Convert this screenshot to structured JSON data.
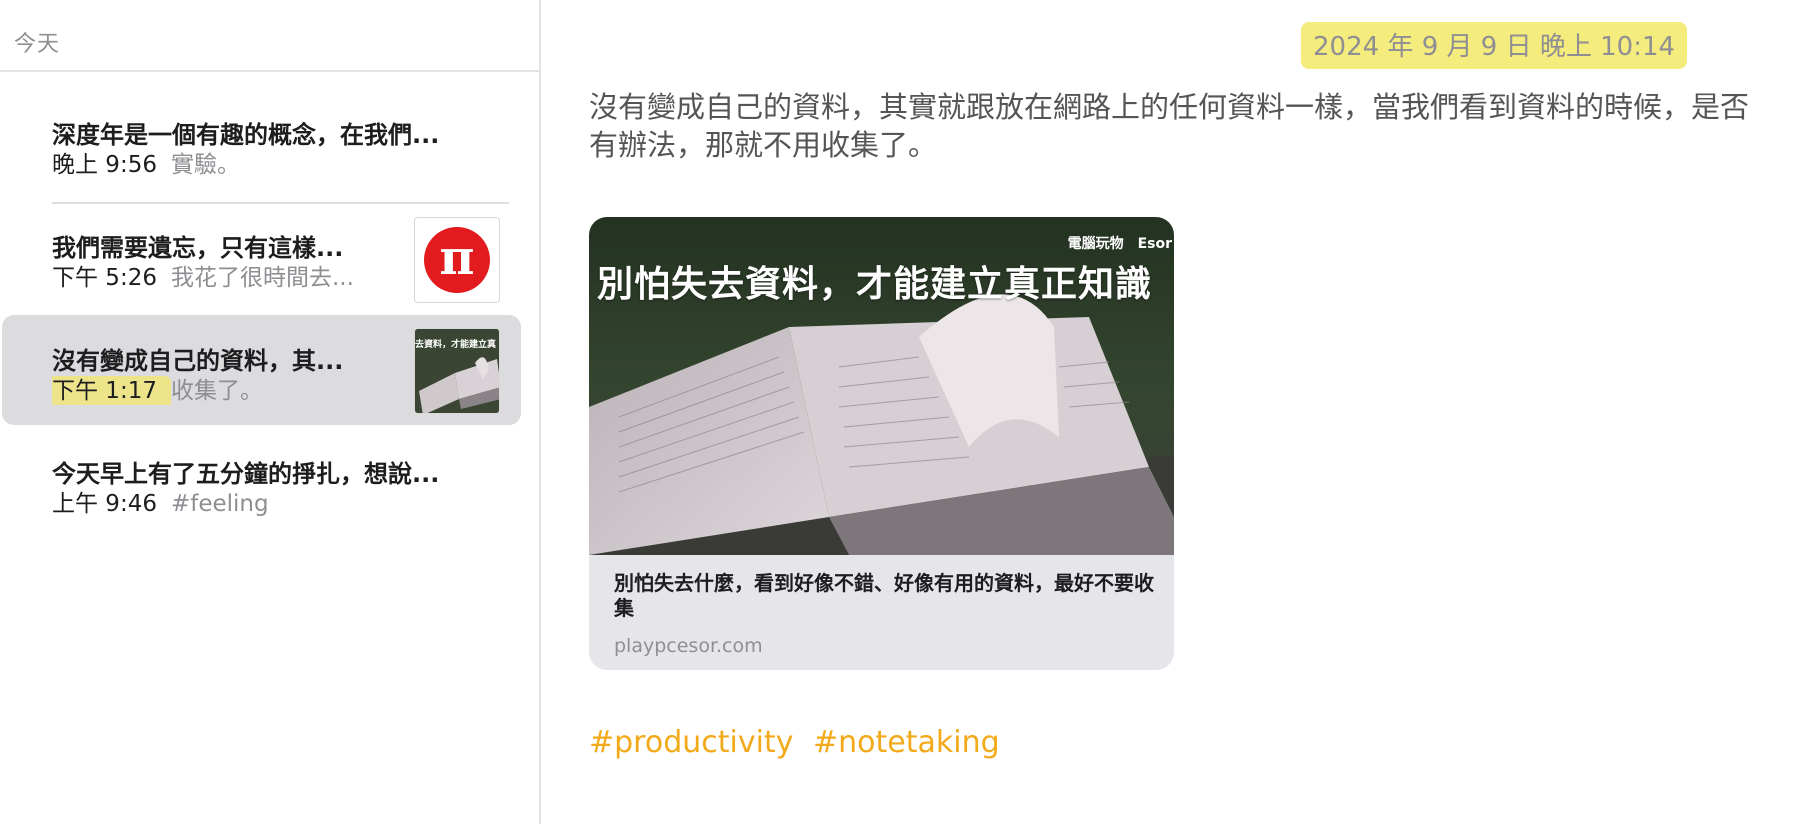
{
  "sidebar": {
    "section_header": "今天",
    "notes": [
      {
        "title": "深度年是一個有趣的概念，在我們...",
        "time": "晚上 9:56",
        "preview": "實驗。"
      },
      {
        "title": "我們需要遺忘，只有這樣...",
        "time": "下午 5:26",
        "preview": "我花了很時間去...",
        "thumb_letter": "π"
      },
      {
        "title": "沒有變成自己的資料，其...",
        "time": "下午 1:17",
        "preview": "收集了。",
        "thumb_caption": "去資料，才能建立真"
      },
      {
        "title": "今天早上有了五分鐘的掙扎，想說...",
        "time": "上午 9:46",
        "preview": "#feeling"
      }
    ]
  },
  "detail": {
    "date_stamp": "2024 年 9 月 9 日 晚上 10:14",
    "body_lines": [
      "沒有變成自己的資料，其實就跟放在網路上的任何資料一樣，當我們看到資料的時候，是否",
      "有辦法，那就不用收集了。"
    ],
    "link_card": {
      "image_tag": "電腦玩物　Esor",
      "image_title": "別怕失去資料，才能建立真正知識",
      "title": "別怕失去什麼，看到好像不錯、好像有用的資料，最好不要收集",
      "domain": "playpcesor.com"
    },
    "tags": [
      "#productivity",
      "#notetaking"
    ]
  },
  "colors": {
    "accent_tag": "#f2a91a",
    "highlight": "#f4ec7c",
    "selected_row": "#dcdcde",
    "pi_logo": "#e21b1f"
  }
}
